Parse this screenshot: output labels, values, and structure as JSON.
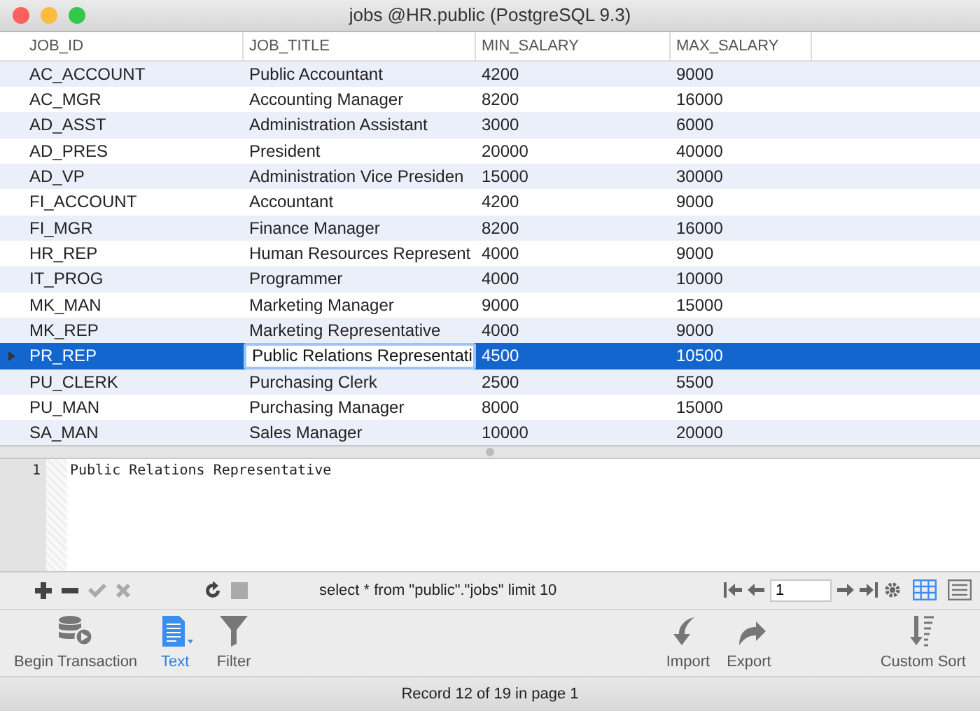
{
  "window": {
    "title": "jobs @HR.public (PostgreSQL 9.3)"
  },
  "table": {
    "columns": [
      "JOB_ID",
      "JOB_TITLE",
      "MIN_SALARY",
      "MAX_SALARY"
    ],
    "rows": [
      {
        "cells": [
          "AC_ACCOUNT",
          "Public Accountant",
          "4200",
          "9000"
        ],
        "selected": false,
        "editing": false
      },
      {
        "cells": [
          "AC_MGR",
          "Accounting Manager",
          "8200",
          "16000"
        ],
        "selected": false,
        "editing": false
      },
      {
        "cells": [
          "AD_ASST",
          "Administration Assistant",
          "3000",
          "6000"
        ],
        "selected": false,
        "editing": false
      },
      {
        "cells": [
          "AD_PRES",
          "President",
          "20000",
          "40000"
        ],
        "selected": false,
        "editing": false
      },
      {
        "cells": [
          "AD_VP",
          "Administration Vice Presiden",
          "15000",
          "30000"
        ],
        "selected": false,
        "editing": false
      },
      {
        "cells": [
          "FI_ACCOUNT",
          "Accountant",
          "4200",
          "9000"
        ],
        "selected": false,
        "editing": false
      },
      {
        "cells": [
          "FI_MGR",
          "Finance Manager",
          "8200",
          "16000"
        ],
        "selected": false,
        "editing": false
      },
      {
        "cells": [
          "HR_REP",
          "Human Resources Represent",
          "4000",
          "9000"
        ],
        "selected": false,
        "editing": false
      },
      {
        "cells": [
          "IT_PROG",
          "Programmer",
          "4000",
          "10000"
        ],
        "selected": false,
        "editing": false
      },
      {
        "cells": [
          "MK_MAN",
          "Marketing Manager",
          "9000",
          "15000"
        ],
        "selected": false,
        "editing": false
      },
      {
        "cells": [
          "MK_REP",
          "Marketing Representative",
          "4000",
          "9000"
        ],
        "selected": false,
        "editing": false
      },
      {
        "cells": [
          "PR_REP",
          "Public Relations Representati",
          "4500",
          "10500"
        ],
        "selected": true,
        "editing": true
      },
      {
        "cells": [
          "PU_CLERK",
          "Purchasing Clerk",
          "2500",
          "5500"
        ],
        "selected": false,
        "editing": false
      },
      {
        "cells": [
          "PU_MAN",
          "Purchasing Manager",
          "8000",
          "15000"
        ],
        "selected": false,
        "editing": false
      },
      {
        "cells": [
          "SA_MAN",
          "Sales Manager",
          "10000",
          "20000"
        ],
        "selected": false,
        "editing": false
      }
    ]
  },
  "editor": {
    "line_number": "1",
    "text": "Public Relations Representative"
  },
  "record_toolbar": {
    "buttons": [
      {
        "kind": "add",
        "disabled": false
      },
      {
        "kind": "remove",
        "disabled": false
      },
      {
        "kind": "apply",
        "disabled": true
      },
      {
        "kind": "cancel",
        "disabled": true
      },
      {
        "kind": "refresh",
        "disabled": false
      },
      {
        "kind": "stop",
        "disabled": true
      }
    ],
    "query": "select * from \"public\".\"jobs\"  limit 10",
    "page": "1",
    "views": [
      {
        "kind": "grid",
        "selected": true
      },
      {
        "kind": "form",
        "selected": false
      }
    ]
  },
  "main_toolbar": [
    {
      "kind": "transaction",
      "label": "Begin Transaction",
      "selected": false
    },
    {
      "kind": "text",
      "label": "Text",
      "selected": true
    },
    {
      "kind": "filter",
      "label": "Filter",
      "selected": false
    },
    {
      "kind": "import",
      "label": "Import",
      "selected": false
    },
    {
      "kind": "export",
      "label": "Export",
      "selected": false
    },
    {
      "kind": "sort",
      "label": "Custom Sort",
      "selected": false
    }
  ],
  "status_bar": "Record 12 of 19 in page 1"
}
